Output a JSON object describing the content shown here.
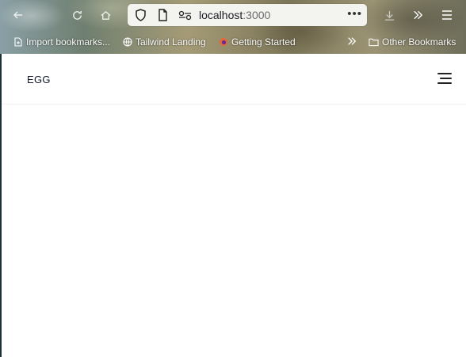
{
  "browser": {
    "url": {
      "host": "localhost",
      "port": ":3000"
    },
    "bookmarks": [
      {
        "label": "Import bookmarks..."
      },
      {
        "label": "Tailwind Landing"
      },
      {
        "label": "Getting Started"
      }
    ],
    "other_bookmarks_label": "Other Bookmarks"
  },
  "site": {
    "brand": "EGG"
  }
}
